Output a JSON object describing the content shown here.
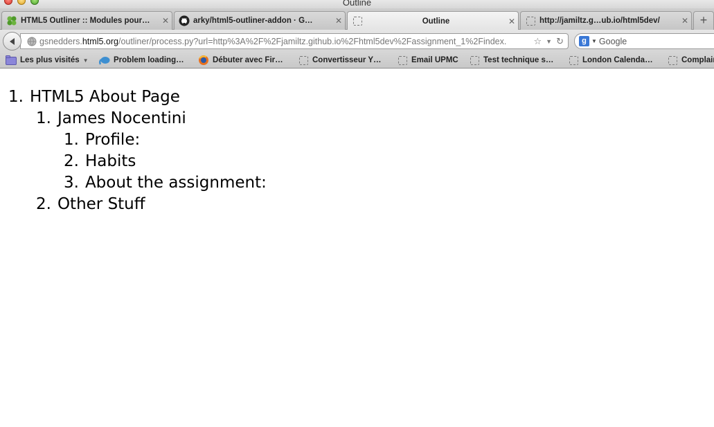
{
  "window": {
    "title": "Outline"
  },
  "tabs": [
    {
      "label": "HTML5 Outliner :: Modules pour…",
      "icon": "puzzle-icon"
    },
    {
      "label": "arky/html5-outliner-addon · G…",
      "icon": "github-icon"
    },
    {
      "label": "Outline",
      "icon": "blank-page-icon",
      "active": true
    },
    {
      "label": "http://jamiltz.g…ub.io/html5dev/",
      "icon": "blank-page-icon"
    }
  ],
  "newtab_label": "+",
  "url": {
    "prefix": "gsnedders.",
    "host": "html5.org",
    "path": "/outliner/process.py?url=http%3A%2F%2Fjamiltz.github.io%2Fhtml5dev%2Fassignment_1%2Findex."
  },
  "search": {
    "placeholder": "Google"
  },
  "bookmarks": [
    {
      "label": "Les plus visités",
      "icon": "folder-icon",
      "has_menu": true
    },
    {
      "label": "Problem loading…",
      "icon": "elephant-icon"
    },
    {
      "label": "Débuter avec Fir…",
      "icon": "firefox-icon"
    },
    {
      "label": "Convertisseur Y…",
      "icon": "blank-page-icon"
    },
    {
      "label": "Email UPMC",
      "icon": "blank-page-icon"
    },
    {
      "label": "Test technique s…",
      "icon": "blank-page-icon"
    },
    {
      "label": "London Calenda…",
      "icon": "blank-page-icon"
    },
    {
      "label": "Complair",
      "icon": "blank-page-icon"
    }
  ],
  "outline": [
    {
      "number": "1.",
      "text": "HTML5 About Page",
      "level": 1
    },
    {
      "number": "1.",
      "text": "James Nocentini",
      "level": 2
    },
    {
      "number": "1.",
      "text": "Profile:",
      "level": 3
    },
    {
      "number": "2.",
      "text": "Habits",
      "level": 3
    },
    {
      "number": "3.",
      "text": "About the assignment:",
      "level": 3
    },
    {
      "number": "2.",
      "text": "Other Stuff",
      "level": 2
    }
  ]
}
